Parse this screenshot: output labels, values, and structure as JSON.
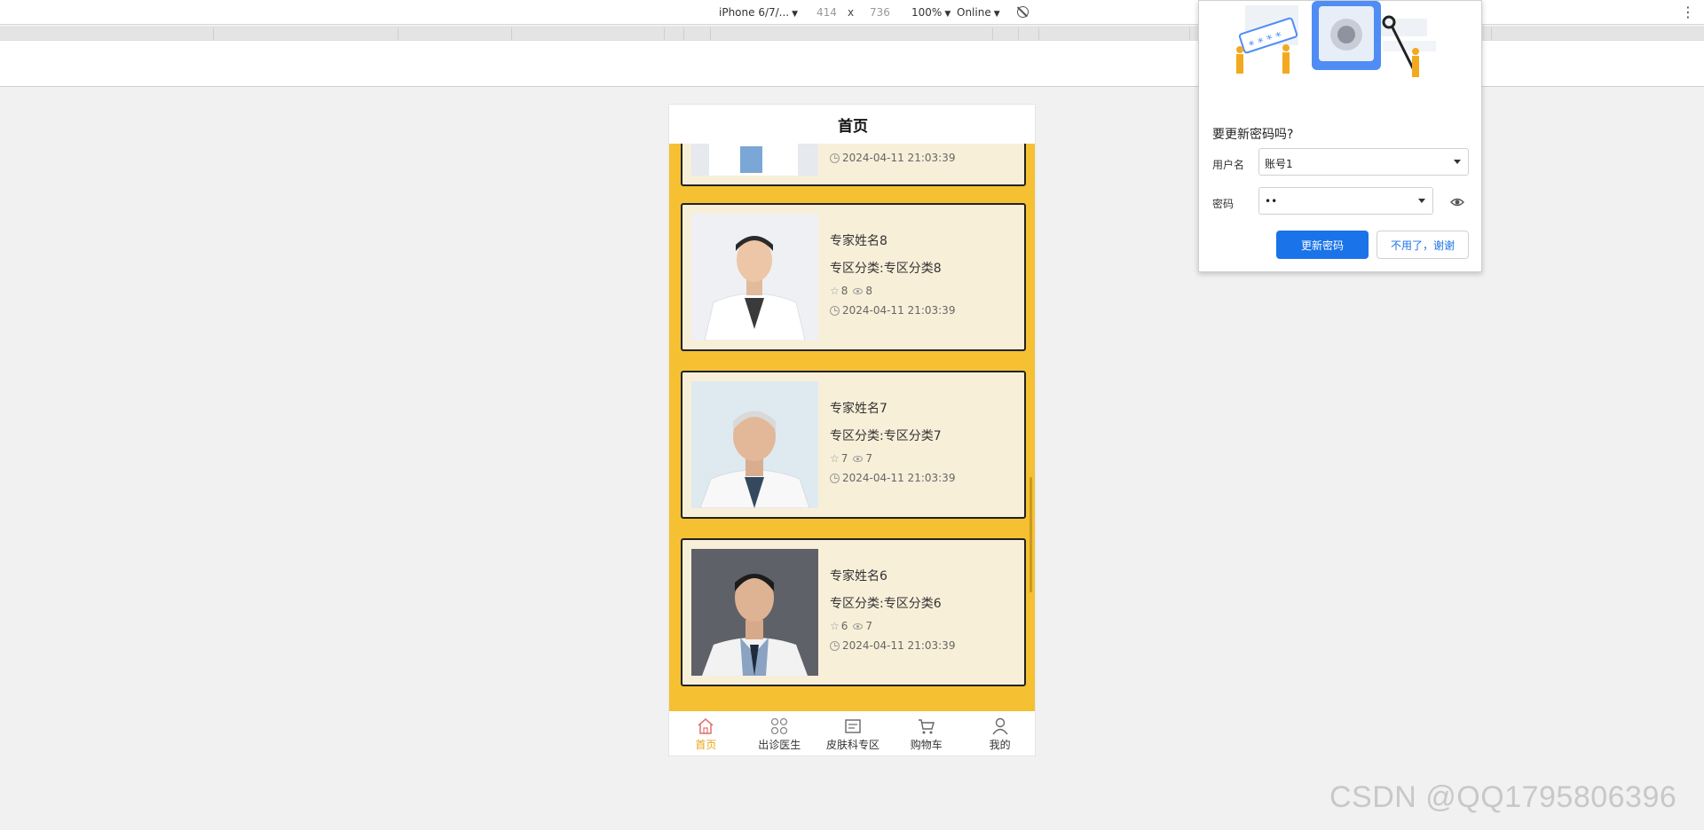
{
  "devtools": {
    "device": "iPhone 6/7/...",
    "width": "414",
    "times": "x",
    "height": "736",
    "zoom": "100%",
    "network": "Online",
    "more_icon": "kebab-icon"
  },
  "app": {
    "title": "首页",
    "partial_card": {
      "time": "2024-04-11 21:03:39"
    },
    "cards": [
      {
        "name": "专家姓名8",
        "category": "专区分类:专区分类8",
        "likes": "8",
        "views": "8",
        "time": "2024-04-11 21:03:39",
        "photo": "doctor-young-male"
      },
      {
        "name": "专家姓名7",
        "category": "专区分类:专区分类7",
        "likes": "7",
        "views": "7",
        "time": "2024-04-11 21:03:39",
        "photo": "doctor-elder-male"
      },
      {
        "name": "专家姓名6",
        "category": "专区分类:专区分类6",
        "likes": "6",
        "views": "7",
        "time": "2024-04-11 21:03:39",
        "photo": "doctor-portrait-male"
      }
    ],
    "tabs": [
      {
        "label": "首页",
        "icon": "home-icon",
        "active": true
      },
      {
        "label": "出诊医生",
        "icon": "grid-icon",
        "active": false
      },
      {
        "label": "皮肤科专区",
        "icon": "board-icon",
        "active": false
      },
      {
        "label": "购物车",
        "icon": "cart-icon",
        "active": false
      },
      {
        "label": "我的",
        "icon": "user-icon",
        "active": false
      }
    ],
    "accent_color": "#f6c033",
    "active_tab_color": "#e8a514"
  },
  "password_popup": {
    "title": "要更新密码吗?",
    "username_label": "用户名",
    "username_value": "账号1",
    "password_label": "密码",
    "password_value": "••",
    "update_button": "更新密码",
    "dismiss_button": "不用了，谢谢",
    "primary_color": "#1a73e8"
  },
  "watermark": "CSDN @QQ1795806396"
}
